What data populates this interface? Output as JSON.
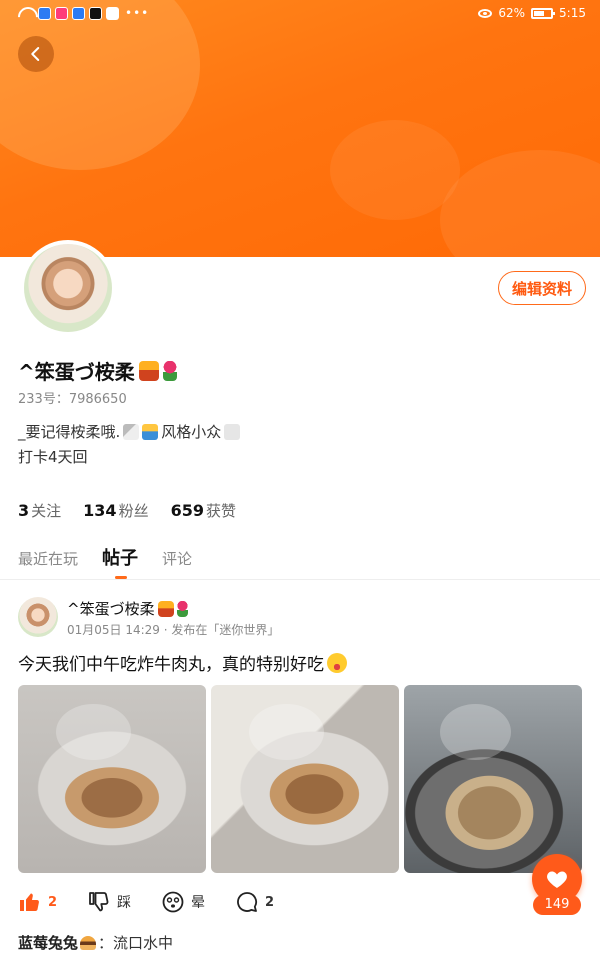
{
  "status_bar": {
    "battery": "62%",
    "time": "5:15",
    "dots": "•••"
  },
  "profile": {
    "username": "^笨蛋づ桉柔",
    "user_id": "233号：7986650",
    "bio_line1_text": "_要记得桉柔哦.",
    "bio_line1_suffix": "风格小众",
    "bio_line2": "打卡4天回",
    "edit_button": "编辑资料",
    "stats": [
      {
        "count": "3",
        "label": "关注"
      },
      {
        "count": "134",
        "label": "粉丝"
      },
      {
        "count": "659",
        "label": "获赞"
      }
    ]
  },
  "tabs": [
    {
      "label": "最近在玩",
      "active": false
    },
    {
      "label": "帖子",
      "active": true
    },
    {
      "label": "评论",
      "active": false
    }
  ],
  "post": {
    "author": "^笨蛋づ桉柔",
    "meta": "01月05日 14:29 · 发布在「迷你世界」",
    "text": "今天我们中午吃炸牛肉丸，真的特别好吃",
    "photo_count": 3,
    "actions": {
      "like_count": "2",
      "dislike_label": "踩",
      "dizzy_label": "晕",
      "comment_count": "2"
    },
    "fab_like_count": "149",
    "top_comment": {
      "name": "蓝莓兔兔",
      "separator": "：",
      "text": "流口水中"
    }
  },
  "colors": {
    "accent": "#ff5a1a",
    "banner": "#ff7410"
  },
  "icons": {
    "back": "chevron-left-icon",
    "like": "thumbs-up-icon",
    "dislike": "thumbs-down-icon",
    "dizzy": "dizzy-face-icon",
    "comment": "comment-bubble-icon",
    "fab": "heart-icon"
  }
}
